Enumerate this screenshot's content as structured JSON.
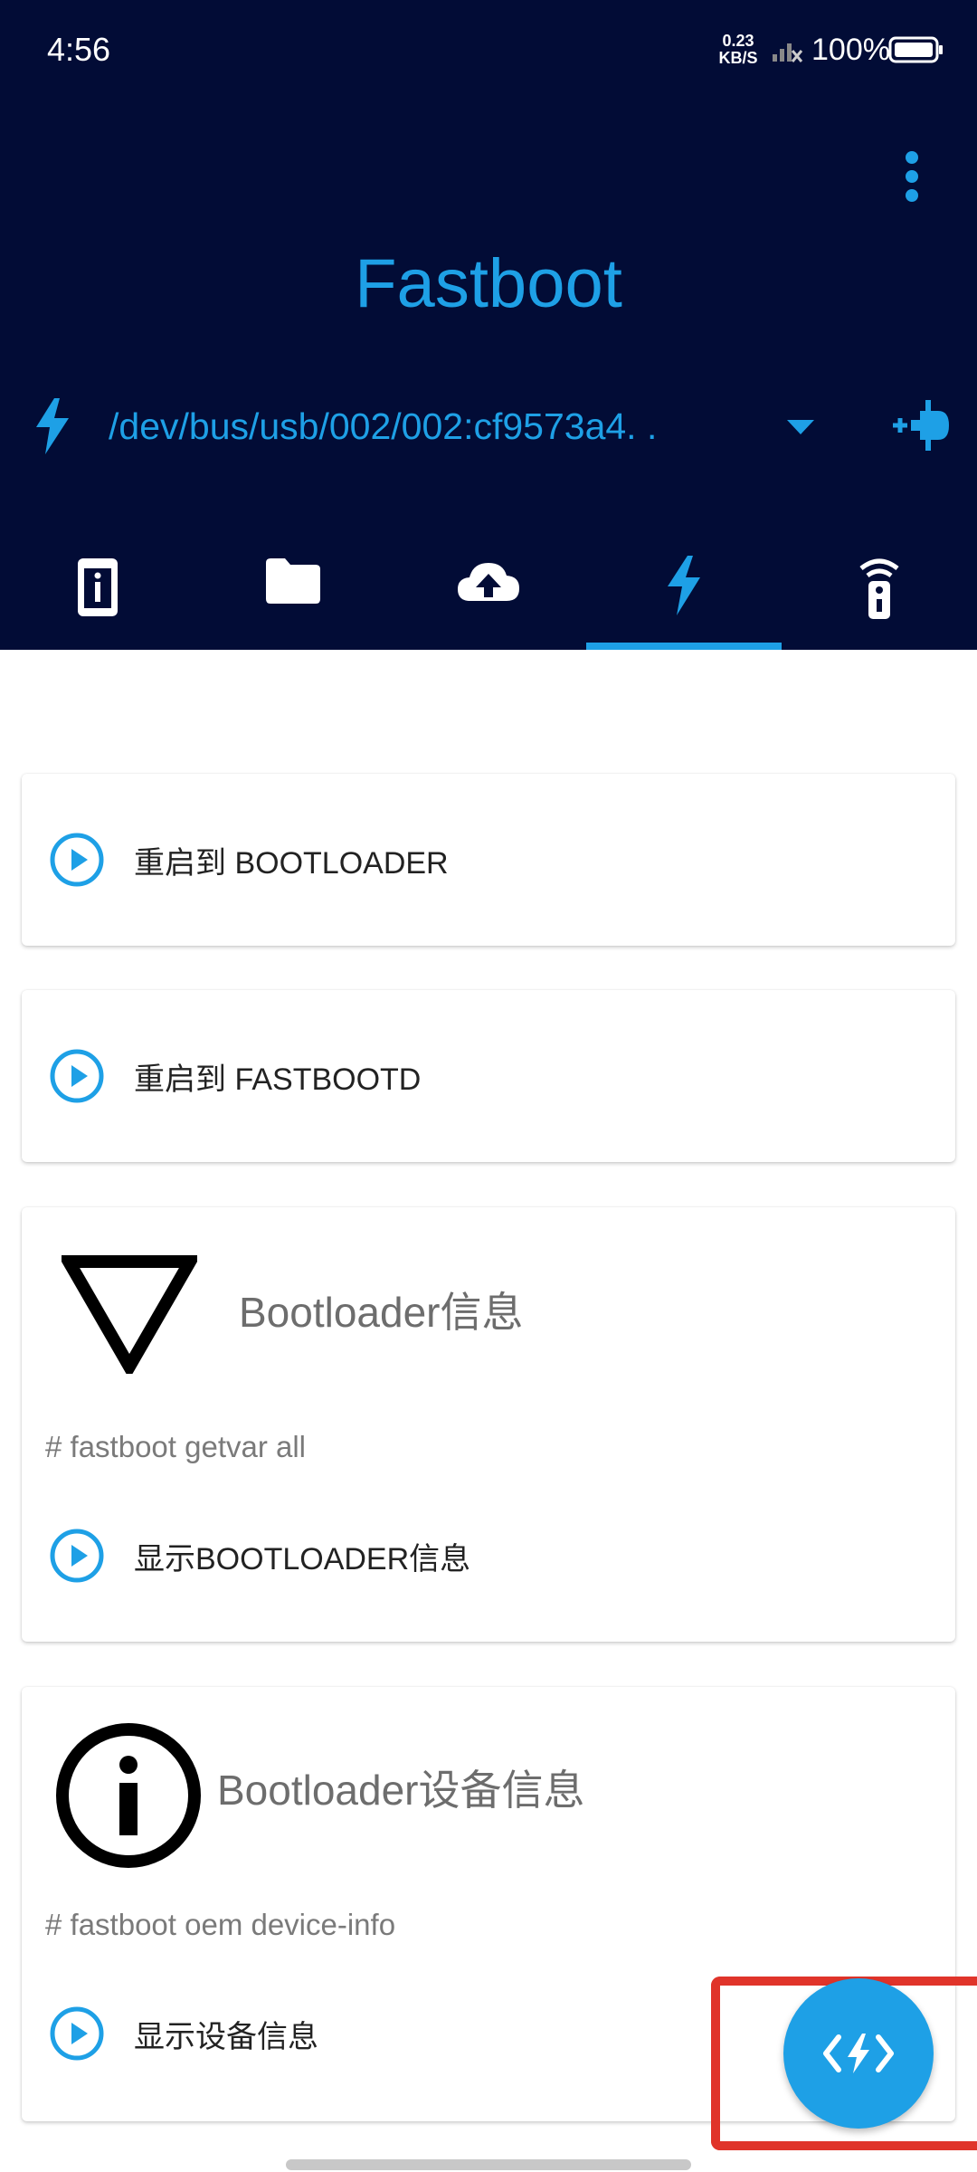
{
  "status_bar": {
    "time": "4:56",
    "net_speed_value": "0.23",
    "net_speed_unit": "KB/S",
    "battery_percent": "100%"
  },
  "header": {
    "title": "Fastboot",
    "device_path": "/dev/bus/usb/002/002:cf9573a4. .",
    "more_icon": "more-vert-icon",
    "add_device_icon": "add-plug-icon"
  },
  "tabs": [
    {
      "icon": "device-info-icon",
      "selected": false
    },
    {
      "icon": "folder-icon",
      "selected": false
    },
    {
      "icon": "cloud-upload-icon",
      "selected": false
    },
    {
      "icon": "flash-icon",
      "selected": true
    },
    {
      "icon": "remote-icon",
      "selected": false
    }
  ],
  "cards": {
    "reboot_bootloader": {
      "action_label": "重启到 BOOTLOADER"
    },
    "reboot_fastbootd": {
      "action_label": "重启到 FASTBOOTD"
    },
    "bootloader_info": {
      "title": "Bootloader信息",
      "command": "# fastboot getvar all",
      "action_label": "显示BOOTLOADER信息",
      "icon": "triangle-down-icon"
    },
    "bootloader_device_info": {
      "title": "Bootloader设备信息",
      "command": "# fastboot oem device-info",
      "action_label": "显示设备信息",
      "icon": "info-circle-icon"
    }
  },
  "fab": {
    "icon": "code-flash-icon"
  },
  "colors": {
    "header_bg": "#020c36",
    "accent": "#1ea0e6",
    "highlight_box": "#e0342a"
  }
}
